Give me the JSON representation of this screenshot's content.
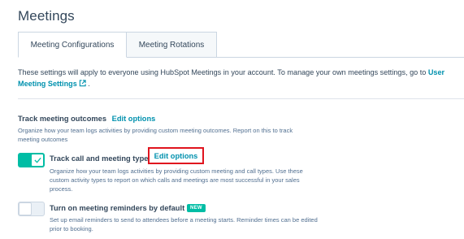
{
  "page": {
    "title": "Meetings"
  },
  "tabs": [
    {
      "label": "Meeting Configurations",
      "active": true
    },
    {
      "label": "Meeting Rotations",
      "active": false
    }
  ],
  "description": {
    "text": "These settings will apply to everyone using HubSpot Meetings in your account. To manage your own meetings settings, go to ",
    "link_label": "User Meeting Settings",
    "link_icon": "external-link-icon",
    "trailing": " ."
  },
  "outcomes": {
    "title": "Track meeting outcomes",
    "edit_label": "Edit options",
    "subtitle": "Organize how your team logs activities by providing custom meeting outcomes. Report on this to track meeting outcomes"
  },
  "options": [
    {
      "title": "Track call and meeting types",
      "edit_label": "Edit options",
      "description": "Organize how your team logs activities by providing custom meeting and call types. Use these custom activity types to report on which calls and meetings are most successful in your sales process.",
      "enabled": true
    },
    {
      "title": "Turn on meeting reminders by default",
      "badge": "NEW",
      "description": "Set up email reminders to send to attendees before a meeting starts. Reminder times can be edited prior to booking.",
      "enabled": false
    }
  ],
  "colors": {
    "accent": "#00bda5",
    "link": "#0091ae",
    "highlight": "#e0141e",
    "text": "#33475b"
  }
}
